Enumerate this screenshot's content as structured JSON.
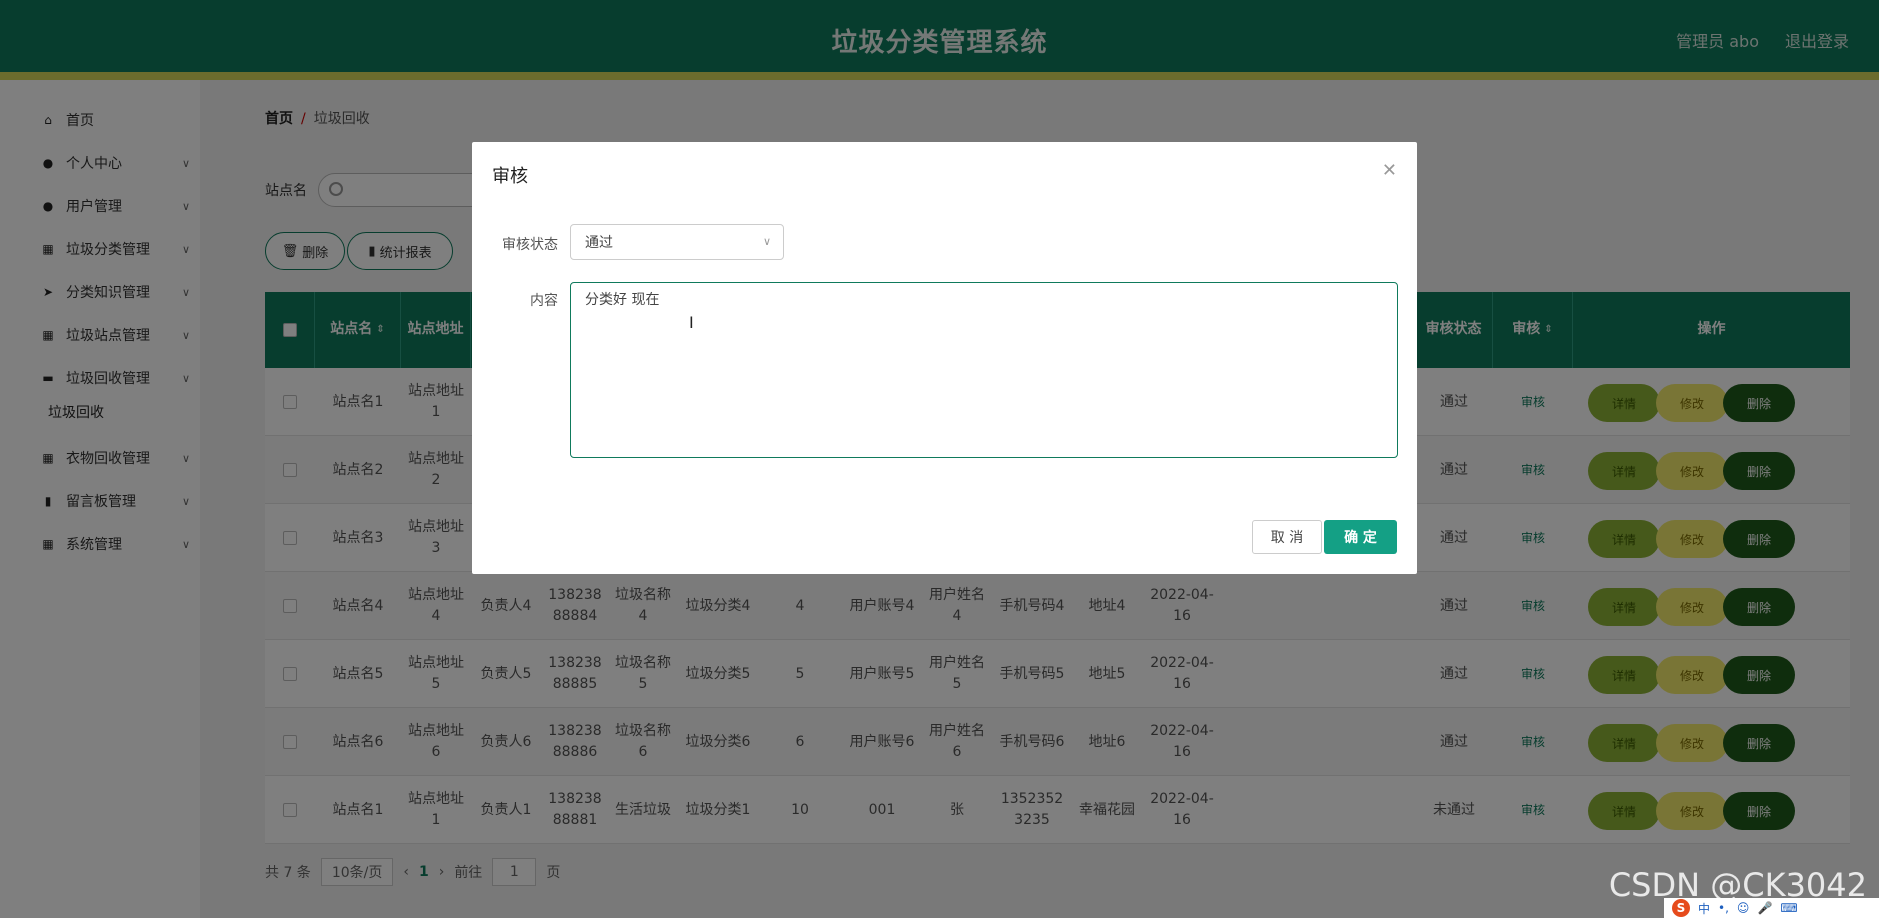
{
  "header": {
    "title": "垃圾分类管理系统",
    "user": "管理员 abo",
    "logout": "退出登录"
  },
  "sidebar": {
    "items": [
      {
        "label": "首页",
        "icon": "home-icon"
      },
      {
        "label": "个人中心",
        "icon": "person-icon"
      },
      {
        "label": "用户管理",
        "icon": "user-manage-icon"
      },
      {
        "label": "垃圾分类管理",
        "icon": "grid-icon"
      },
      {
        "label": "分类知识管理",
        "icon": "send-icon"
      },
      {
        "label": "垃圾站点管理",
        "icon": "grid-icon"
      },
      {
        "label": "垃圾回收管理",
        "icon": "briefcase-icon"
      },
      {
        "label": "衣物回收管理",
        "icon": "grid-icon"
      },
      {
        "label": "留言板管理",
        "icon": "bar-chart-icon"
      },
      {
        "label": "系统管理",
        "icon": "grid-icon"
      }
    ],
    "sub_item": "垃圾回收"
  },
  "breadcrumb": {
    "home": "首页",
    "sep": "/",
    "current": "垃圾回收"
  },
  "search": {
    "label": "站点名"
  },
  "toolbar": {
    "delete": "删除",
    "report": "统计报表"
  },
  "table": {
    "headers": {
      "site": "站点名",
      "address": "站点地址",
      "status": "审核状态",
      "review": "审核",
      "ops": "操作"
    },
    "rows": [
      {
        "site": "站点名1",
        "addr": "站点地址1",
        "person": "",
        "phone": "",
        "name": "",
        "cls": "",
        "n": "",
        "acct": "",
        "uname": "",
        "mobile": "",
        "loc": "",
        "date": "",
        "status": "通过"
      },
      {
        "site": "站点名2",
        "addr": "站点地址2",
        "person": "",
        "phone": "",
        "name": "",
        "cls": "",
        "n": "",
        "acct": "",
        "uname": "",
        "mobile": "",
        "loc": "",
        "date": "",
        "status": "通过"
      },
      {
        "site": "站点名3",
        "addr": "站点地址3",
        "person": "",
        "phone": "",
        "name": "",
        "cls": "",
        "n": "",
        "acct": "",
        "uname": "",
        "mobile": "",
        "loc": "",
        "date": "",
        "status": "通过"
      },
      {
        "site": "站点名4",
        "addr": "站点地址4",
        "person": "负责人4",
        "phone": "13823888884",
        "name": "垃圾名称4",
        "cls": "垃圾分类4",
        "n": "4",
        "acct": "用户账号4",
        "uname": "用户姓名4",
        "mobile": "手机号码4",
        "loc": "地址4",
        "date": "2022-04-16",
        "status": "通过"
      },
      {
        "site": "站点名5",
        "addr": "站点地址5",
        "person": "负责人5",
        "phone": "13823888885",
        "name": "垃圾名称5",
        "cls": "垃圾分类5",
        "n": "5",
        "acct": "用户账号5",
        "uname": "用户姓名5",
        "mobile": "手机号码5",
        "loc": "地址5",
        "date": "2022-04-16",
        "status": "通过"
      },
      {
        "site": "站点名6",
        "addr": "站点地址6",
        "person": "负责人6",
        "phone": "13823888886",
        "name": "垃圾名称6",
        "cls": "垃圾分类6",
        "n": "6",
        "acct": "用户账号6",
        "uname": "用户姓名6",
        "mobile": "手机号码6",
        "loc": "地址6",
        "date": "2022-04-16",
        "status": "通过"
      },
      {
        "site": "站点名1",
        "addr": "站点地址1",
        "person": "负责人1",
        "phone": "13823888881",
        "name": "生活垃圾",
        "cls": "垃圾分类1",
        "n": "10",
        "acct": "001",
        "uname": "张",
        "mobile": "13523523235",
        "loc": "幸福花园",
        "date": "2022-04-16",
        "status": "未通过"
      }
    ],
    "review_btn": "审核",
    "view_btn": "详情",
    "edit_btn": "修改",
    "del_btn": "删除"
  },
  "pager": {
    "total": "共 7 条",
    "size": "10条/页",
    "page": "1",
    "goto": "前往",
    "goto_val": "1",
    "unit": "页"
  },
  "dialog": {
    "title": "审核",
    "status_label": "审核状态",
    "status_value": "通过",
    "content_label": "内容",
    "content_value": "分类好   现在",
    "cancel": "取 消",
    "ok": "确 定"
  },
  "watermark": "CSDN @CK3042"
}
